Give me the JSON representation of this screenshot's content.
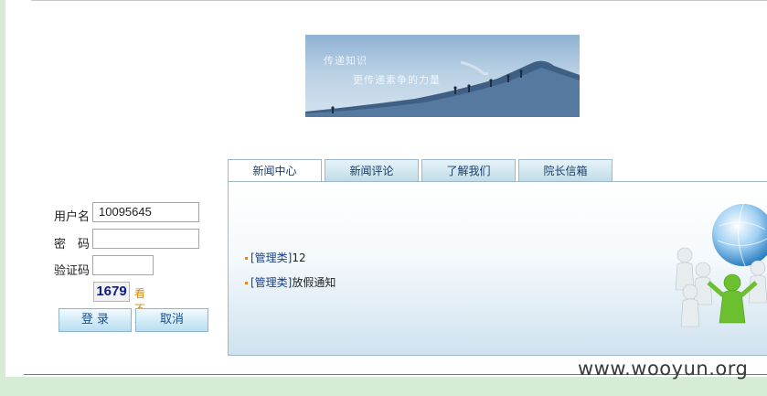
{
  "banner": {
    "line1": "传递知识",
    "line2": "更传递素争的力量"
  },
  "login": {
    "username_label": "用户名",
    "username_value": "10095645",
    "password_label": "密　码",
    "password_value": "",
    "captcha_label": "验证码",
    "captcha_value": "",
    "captcha_code": "1679",
    "captcha_refresh": "看不清",
    "login_button": "登 录",
    "cancel_button": "取消"
  },
  "tabs": [
    {
      "label": "新闻中心",
      "active": true
    },
    {
      "label": "新闻评论",
      "active": false
    },
    {
      "label": "了解我们",
      "active": false
    },
    {
      "label": "院长信箱",
      "active": false
    }
  ],
  "news": [
    {
      "category": "[管理类]",
      "title": "12"
    },
    {
      "category": "[管理类]",
      "title": "放假通知"
    }
  ],
  "watermark": "www.wooyun.org",
  "colors": {
    "background": "#d6ecd4",
    "tab_text": "#1a3c6b",
    "bullet": "#e28b21",
    "captcha_text": "#0b1d86",
    "captcha_refresh": "#d98a00"
  }
}
